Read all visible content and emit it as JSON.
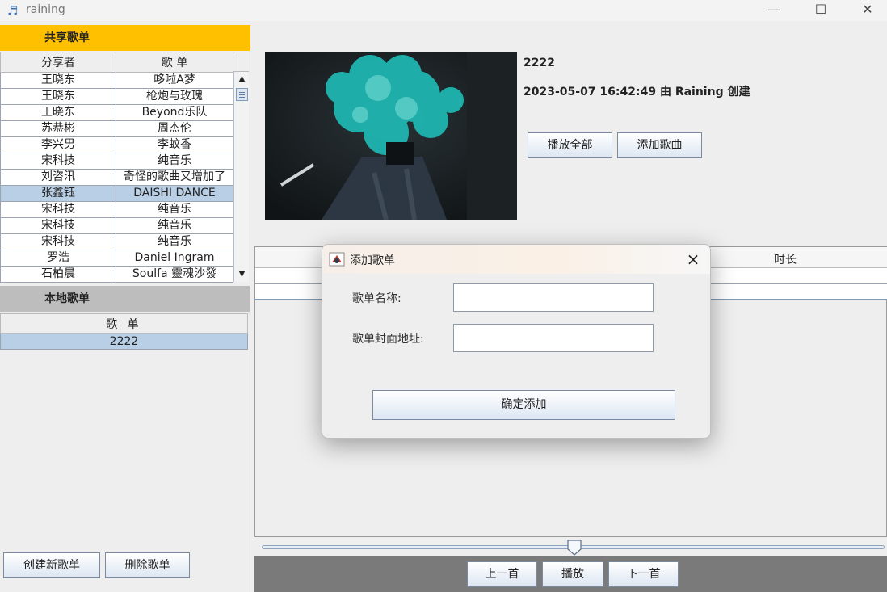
{
  "window": {
    "title": "raining",
    "minimize_glyph": "—",
    "maximize_glyph": "☐",
    "close_glyph": "✕"
  },
  "shared": {
    "title": "共享歌单",
    "columns": [
      "分享者",
      "歌 单"
    ],
    "rows": [
      [
        "王晓东",
        "哆啦A梦"
      ],
      [
        "王晓东",
        "枪炮与玫瑰"
      ],
      [
        "王晓东",
        "Beyond乐队"
      ],
      [
        "苏恭彬",
        "周杰伦"
      ],
      [
        "李兴男",
        "李蚊香"
      ],
      [
        "宋科技",
        "纯音乐"
      ],
      [
        "刘咨汛",
        "奇怪的歌曲又增加了"
      ],
      [
        "张鑫钰",
        "DAISHI DANCE"
      ],
      [
        "宋科技",
        "纯音乐"
      ],
      [
        "宋科技",
        "纯音乐"
      ],
      [
        "宋科技",
        "纯音乐"
      ],
      [
        "罗浩",
        "Daniel Ingram"
      ],
      [
        "石柏晨",
        "Soulfa 靈魂沙發"
      ]
    ],
    "selected_row": 7
  },
  "local": {
    "title": "本地歌单",
    "column": "歌 单",
    "rows": [
      "2222"
    ]
  },
  "left_buttons": {
    "create": "创建新歌单",
    "delete": "删除歌单"
  },
  "playlist": {
    "name": "2222",
    "meta": "2023-05-07 16:42:49 由 Raining 创建",
    "play_all": "播放全部",
    "add_song": "添加歌曲",
    "col_duration": "时长"
  },
  "playback": {
    "progress": 0.5,
    "prev": "上一首",
    "play": "播放",
    "next": "下一首"
  },
  "dialog": {
    "title": "添加歌单",
    "name_label": "歌单名称:",
    "name_value": "",
    "cover_label": "歌单封面地址:",
    "cover_value": "",
    "confirm": "确定添加"
  },
  "colors": {
    "shared_header": "#ffc000",
    "local_header": "#bdbdbd",
    "selection": "#b8cfe5",
    "controls_bar": "#7a7a7a"
  }
}
